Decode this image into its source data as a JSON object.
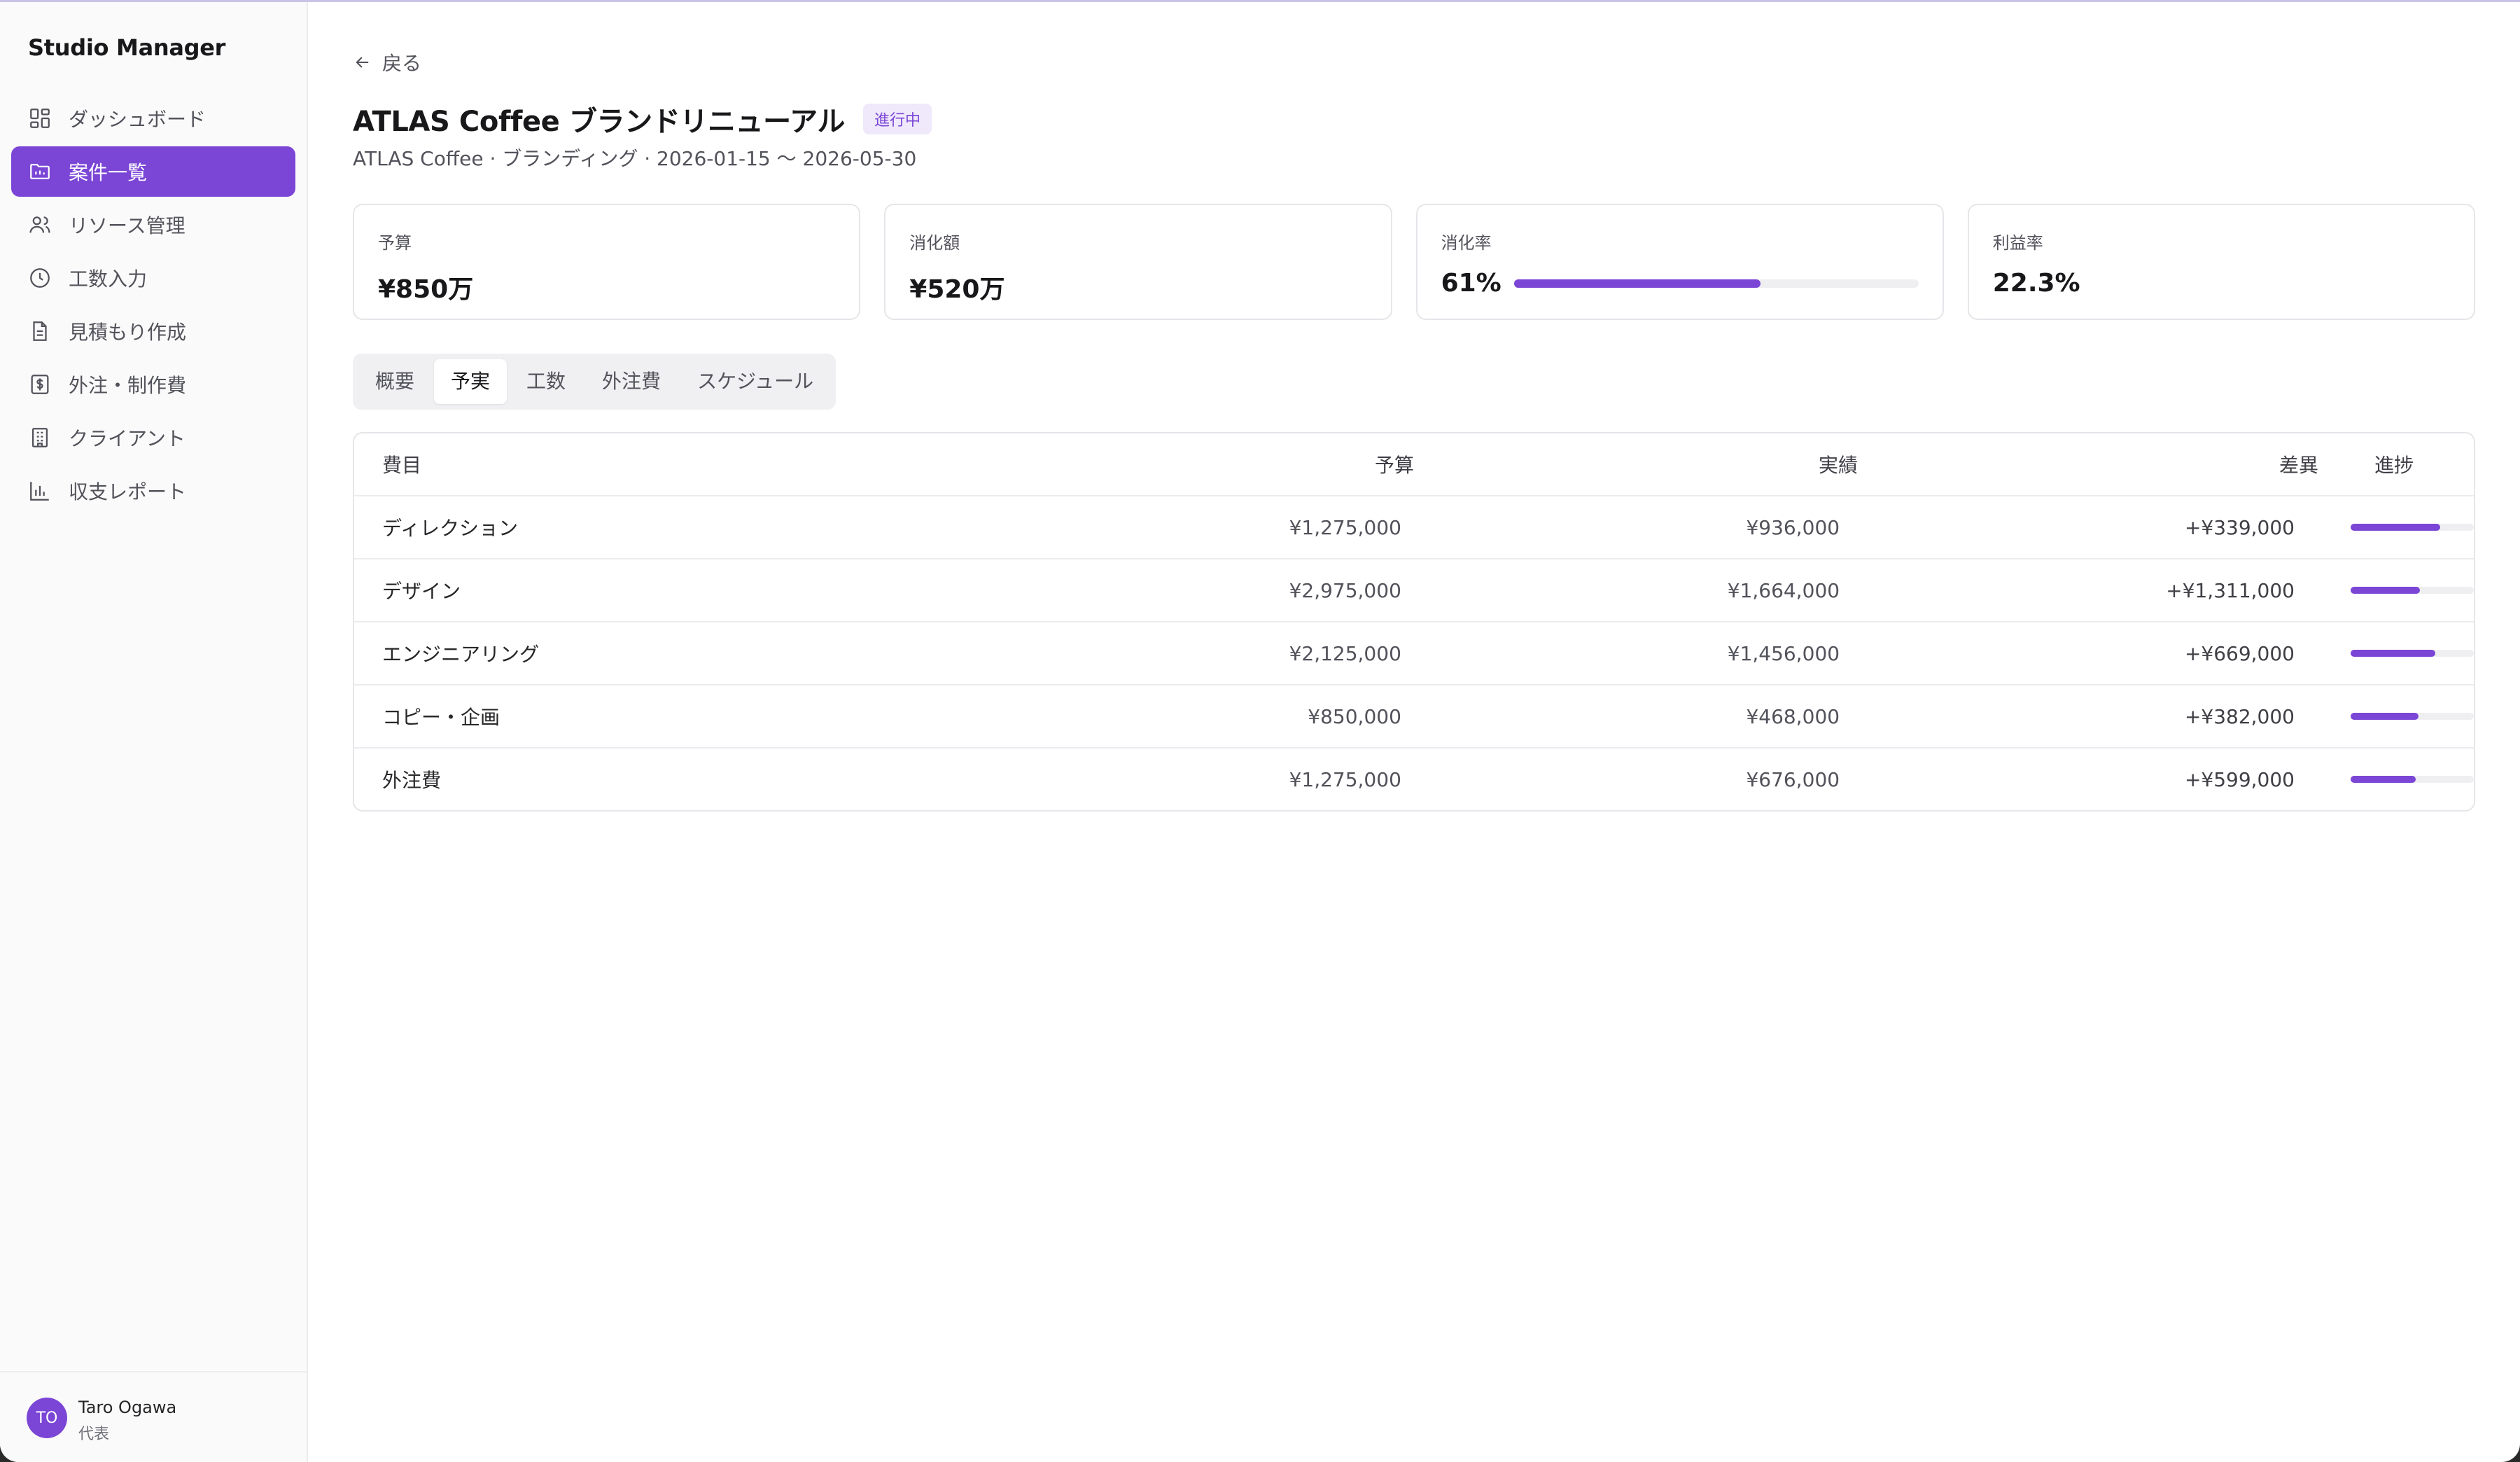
{
  "app": {
    "title": "Studio Manager"
  },
  "sidebar": {
    "items": [
      {
        "label": "ダッシュボード",
        "icon": "dashboard-icon",
        "active": false
      },
      {
        "label": "案件一覧",
        "icon": "folder-icon",
        "active": true
      },
      {
        "label": "リソース管理",
        "icon": "users-icon",
        "active": false
      },
      {
        "label": "工数入力",
        "icon": "clock-icon",
        "active": false
      },
      {
        "label": "見積もり作成",
        "icon": "document-icon",
        "active": false
      },
      {
        "label": "外注・制作費",
        "icon": "dollar-icon",
        "active": false
      },
      {
        "label": "クライアント",
        "icon": "building-icon",
        "active": false
      },
      {
        "label": "収支レポート",
        "icon": "bar-chart-icon",
        "active": false
      }
    ],
    "user": {
      "initials": "TO",
      "name": "Taro Ogawa",
      "role": "代表"
    }
  },
  "header": {
    "back_label": "戻る",
    "title": "ATLAS Coffee ブランドリニューアル",
    "status": "進行中",
    "subtitle": "ATLAS Coffee · ブランディング · 2026-01-15 〜 2026-05-30"
  },
  "kpis": {
    "budget": {
      "label": "予算",
      "value": "¥850万"
    },
    "spent": {
      "label": "消化額",
      "value": "¥520万"
    },
    "rate": {
      "label": "消化率",
      "value": "61%",
      "progress": 0.61
    },
    "margin": {
      "label": "利益率",
      "value": "22.3%"
    }
  },
  "tabs": [
    {
      "label": "概要",
      "active": false
    },
    {
      "label": "予実",
      "active": true
    },
    {
      "label": "工数",
      "active": false
    },
    {
      "label": "外注費",
      "active": false
    },
    {
      "label": "スケジュール",
      "active": false
    }
  ],
  "table": {
    "headers": {
      "name": "費目",
      "budget": "予算",
      "actual": "実績",
      "diff": "差異",
      "progress": "進捗"
    },
    "rows": [
      {
        "name": "ディレクション",
        "budget": "¥1,275,000",
        "actual": "¥936,000",
        "diff": "+¥339,000",
        "progress": 0.73
      },
      {
        "name": "デザイン",
        "budget": "¥2,975,000",
        "actual": "¥1,664,000",
        "diff": "+¥1,311,000",
        "progress": 0.56
      },
      {
        "name": "エンジニアリング",
        "budget": "¥2,125,000",
        "actual": "¥1,456,000",
        "diff": "+¥669,000",
        "progress": 0.69
      },
      {
        "name": "コピー・企画",
        "budget": "¥850,000",
        "actual": "¥468,000",
        "diff": "+¥382,000",
        "progress": 0.55
      },
      {
        "name": "外注費",
        "budget": "¥1,275,000",
        "actual": "¥676,000",
        "diff": "+¥599,000",
        "progress": 0.53
      }
    ]
  },
  "colors": {
    "accent": "#7b45d6",
    "accent_light": "#efe9fb"
  }
}
